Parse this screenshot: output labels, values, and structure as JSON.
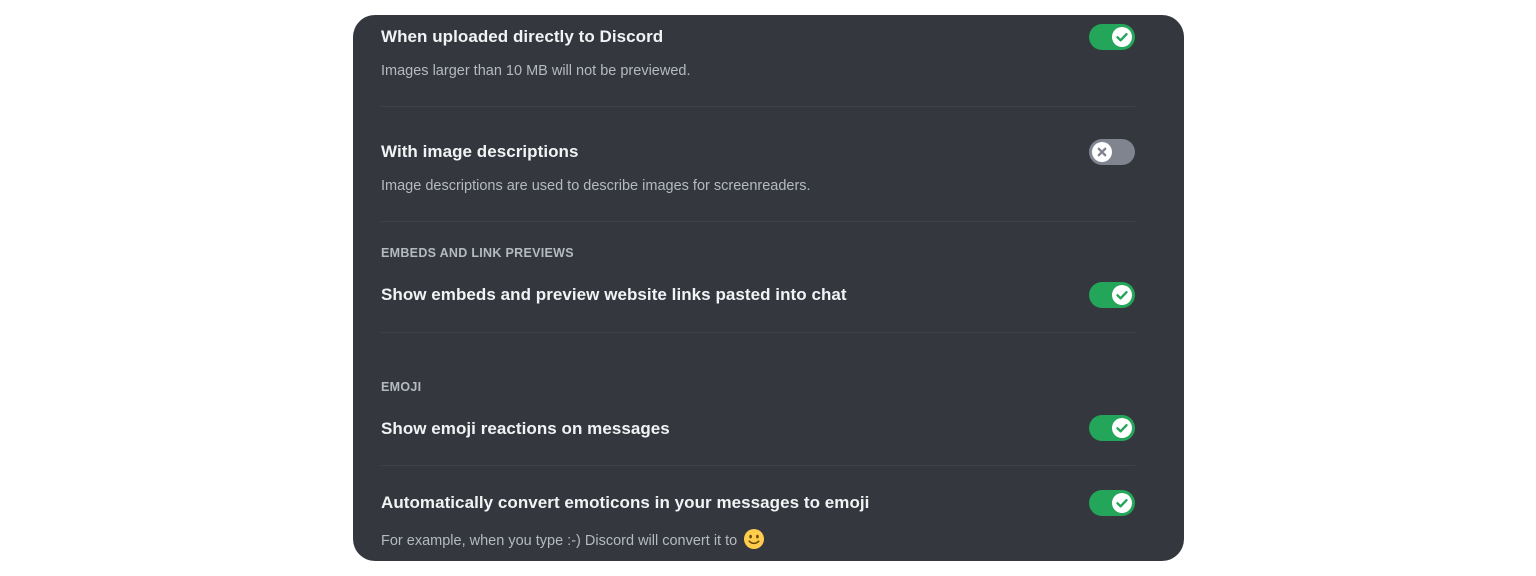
{
  "settings": {
    "upload_direct": {
      "title": "When uploaded directly to Discord",
      "description": "Images larger than 10 MB will not be previewed.",
      "enabled": true
    },
    "image_descriptions": {
      "title": "With image descriptions",
      "description": "Image descriptions are used to describe images for screenreaders.",
      "enabled": false
    },
    "embeds_section": {
      "label": "EMBEDS AND LINK PREVIEWS"
    },
    "show_embeds": {
      "title": "Show embeds and preview website links pasted into chat",
      "enabled": true
    },
    "emoji_section": {
      "label": "EMOJI"
    },
    "emoji_reactions": {
      "title": "Show emoji reactions on messages",
      "enabled": true
    },
    "convert_emoticons": {
      "title": "Automatically convert emoticons in your messages to emoji",
      "description": "For example, when you type :-) Discord will convert it to",
      "enabled": true
    }
  },
  "icons": {
    "toggle_on": "check-icon",
    "toggle_off": "x-icon",
    "example_emoji": "slightly-smiling-face-icon"
  },
  "colors": {
    "panel_bg": "#34373d",
    "toggle_on": "#23a55a",
    "toggle_off": "#80848e",
    "title_text": "#f2f3f5",
    "description_text": "#b5bac1"
  }
}
